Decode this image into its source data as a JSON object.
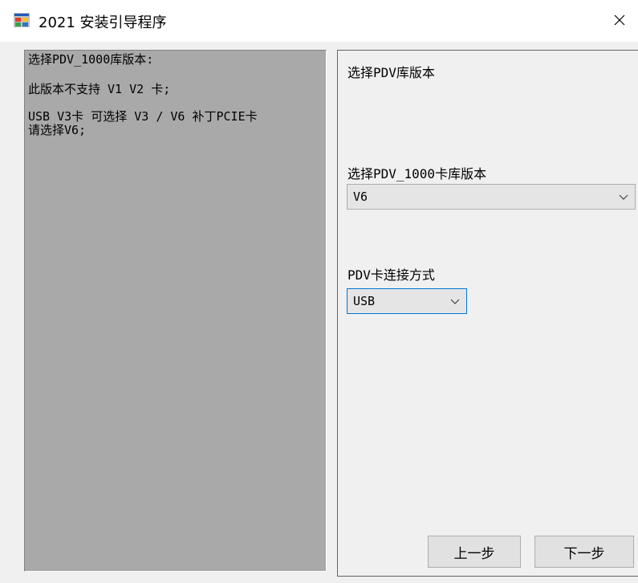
{
  "window": {
    "title": "2021 安装引导程序",
    "app_icon": "installer-icon"
  },
  "left_panel": {
    "lines": [
      "选择PDV_1000库版本:",
      "此版本不支持 V1 V2 卡;",
      "USB V3卡 可选择 V3 / V6 补丁PCIE卡\n请选择V6;"
    ]
  },
  "right_panel": {
    "heading": "选择PDV库版本",
    "library_version": {
      "label": "选择PDV_1000卡库版本",
      "selected": "V6"
    },
    "connection": {
      "label": "PDV卡连接方式",
      "selected": "USB"
    },
    "buttons": {
      "prev": "上一步",
      "next": "下一步"
    }
  },
  "colors": {
    "left_panel_bg": "#a9a9a9",
    "window_bg": "#f0f0f0",
    "focus_border": "#0078d7"
  }
}
